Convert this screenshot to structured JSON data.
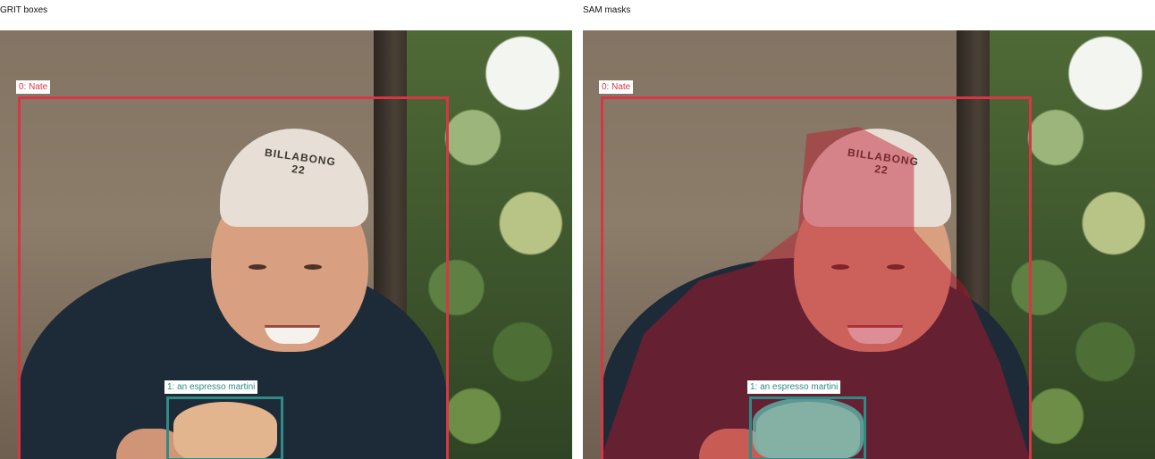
{
  "panels": [
    {
      "title": "GRIT boxes",
      "labels": {
        "person": "0: Nate",
        "cup": "1: an espresso martini"
      },
      "mask_overlay": false
    },
    {
      "title": "SAM masks",
      "labels": {
        "person": "0: Nate",
        "cup": "1: an espresso martini"
      },
      "mask_overlay": true
    }
  ],
  "photo": {
    "cap_text": "BILLABONG 22"
  },
  "colors": {
    "person_box": "#d93544",
    "cup_box": "#2e8b86",
    "person_mask": "#be142d",
    "cup_mask": "#5ad7c8"
  }
}
